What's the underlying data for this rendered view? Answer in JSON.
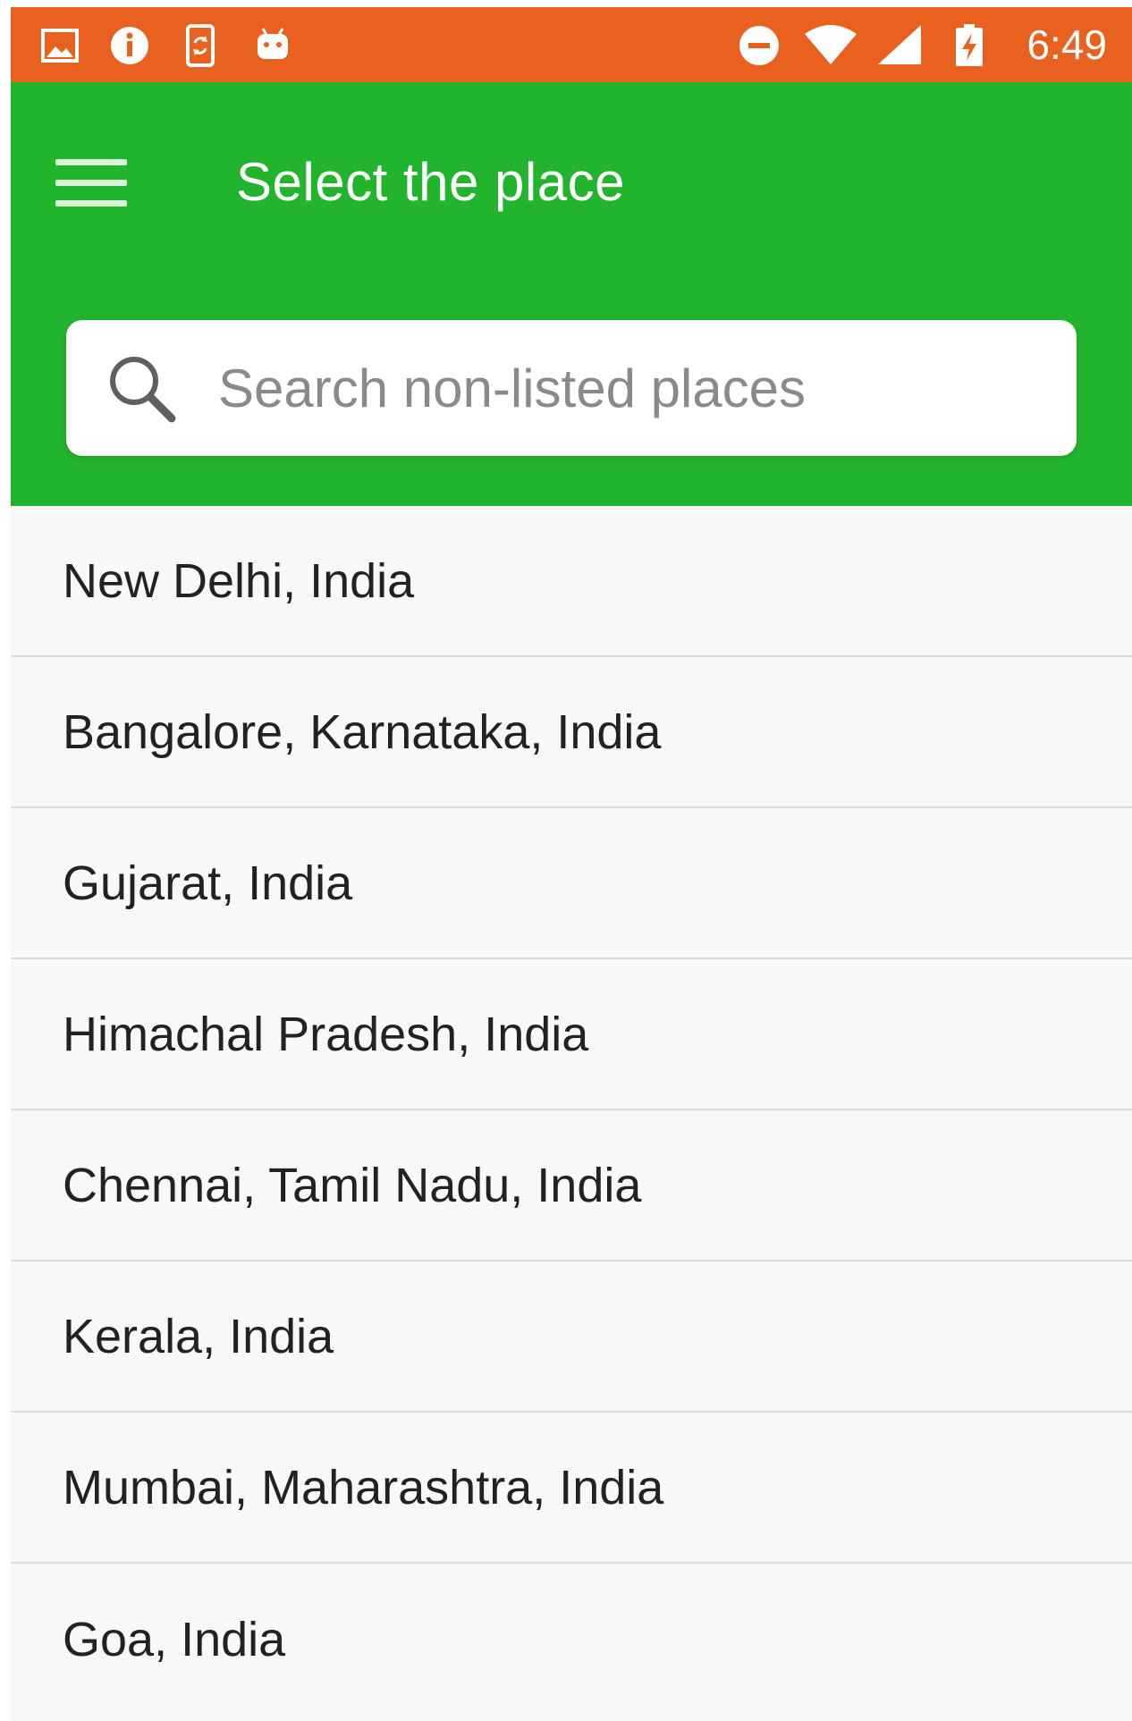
{
  "status_bar": {
    "time": "6:49",
    "background_color": "#e8611e",
    "left_icons": [
      "image-icon",
      "info-icon",
      "phone-sync-icon",
      "android-icon"
    ],
    "right_icons": [
      "do-not-disturb-icon",
      "wifi-icon",
      "cell-signal-icon",
      "battery-charging-icon"
    ]
  },
  "app_bar": {
    "title": "Select the place",
    "background_color": "#22b42c",
    "menu_icon": "hamburger-menu-icon"
  },
  "search": {
    "placeholder": "Search non-listed places",
    "value": "",
    "icon": "search-icon"
  },
  "places": [
    {
      "label": "New Delhi, India"
    },
    {
      "label": "Bangalore, Karnataka, India"
    },
    {
      "label": "Gujarat, India"
    },
    {
      "label": "Himachal Pradesh, India"
    },
    {
      "label": "Chennai, Tamil Nadu, India"
    },
    {
      "label": "Kerala, India"
    },
    {
      "label": "Mumbai, Maharashtra, India"
    },
    {
      "label": "Goa, India"
    }
  ]
}
